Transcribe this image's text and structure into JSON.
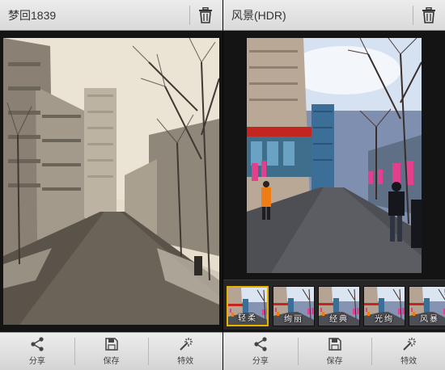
{
  "left_panel": {
    "title": "梦回1839",
    "photo_style": "sepia",
    "toolbar": [
      {
        "label": "分享",
        "icon": "share-icon"
      },
      {
        "label": "保存",
        "icon": "save-icon"
      },
      {
        "label": "特效",
        "icon": "magic-wand-icon"
      }
    ]
  },
  "right_panel": {
    "title": "风景(HDR)",
    "photo_style": "hdr-color",
    "filters": [
      {
        "label": "轻柔",
        "selected": true
      },
      {
        "label": "绚丽",
        "selected": false
      },
      {
        "label": "经典",
        "selected": false
      },
      {
        "label": "光绚",
        "selected": false
      },
      {
        "label": "风暴",
        "selected": false
      }
    ],
    "toolbar": [
      {
        "label": "分享",
        "icon": "share-icon"
      },
      {
        "label": "保存",
        "icon": "save-icon"
      },
      {
        "label": "特效",
        "icon": "magic-wand-icon"
      }
    ]
  },
  "colors": {
    "selected_border": "#e9b200",
    "bar_bg": "#e3e3e3",
    "app_bg": "#141414"
  }
}
